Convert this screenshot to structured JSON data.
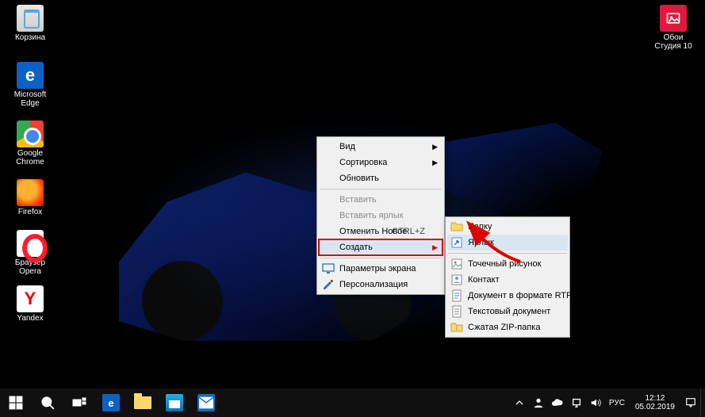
{
  "desktop_icons": {
    "recycle": "Корзина",
    "edge": "Microsoft Edge",
    "chrome": "Google Chrome",
    "firefox": "Firefox",
    "opera": "Браузер Opera",
    "yandex": "Yandex",
    "wallapp": "Обои Студия 10"
  },
  "context_menu": {
    "view": "Вид",
    "sort": "Сортировка",
    "refresh": "Обновить",
    "paste": "Вставить",
    "paste_shortcut": "Вставить ярлык",
    "undo_new": "Отменить Новое",
    "undo_new_key": "CTRL+Z",
    "create": "Создать",
    "display_settings": "Параметры экрана",
    "personalize": "Персонализация"
  },
  "submenu": {
    "folder": "Папку",
    "shortcut": "Ярлык",
    "bitmap": "Точечный рисунок",
    "contact": "Контакт",
    "rtf": "Документ в формате RTF",
    "txt": "Текстовый документ",
    "zip": "Сжатая ZIP-папка"
  },
  "tray": {
    "lang": "РУС",
    "time": "12:12",
    "date": "05.02.2019"
  }
}
